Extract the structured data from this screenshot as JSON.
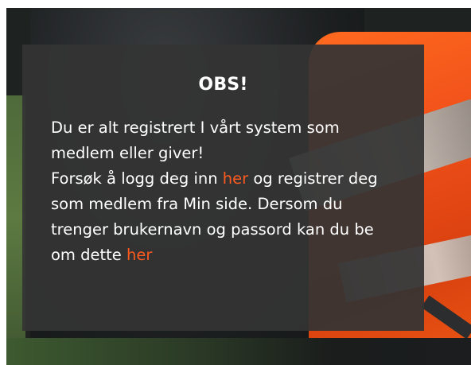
{
  "notice": {
    "title": "OBS!",
    "line1": "Du er alt registrert I vårt system som medlem eller giver!",
    "line2_before": "Forsøk å logg deg inn ",
    "link_login": "her",
    "line2_after": " og registrer deg som medlem fra Min side. Dersom du trenger brukernavn og passord kan du be om dette ",
    "link_password": "her"
  },
  "colors": {
    "overlay_bg": "#343434",
    "link": "#ff5a1f",
    "text": "#ffffff"
  }
}
